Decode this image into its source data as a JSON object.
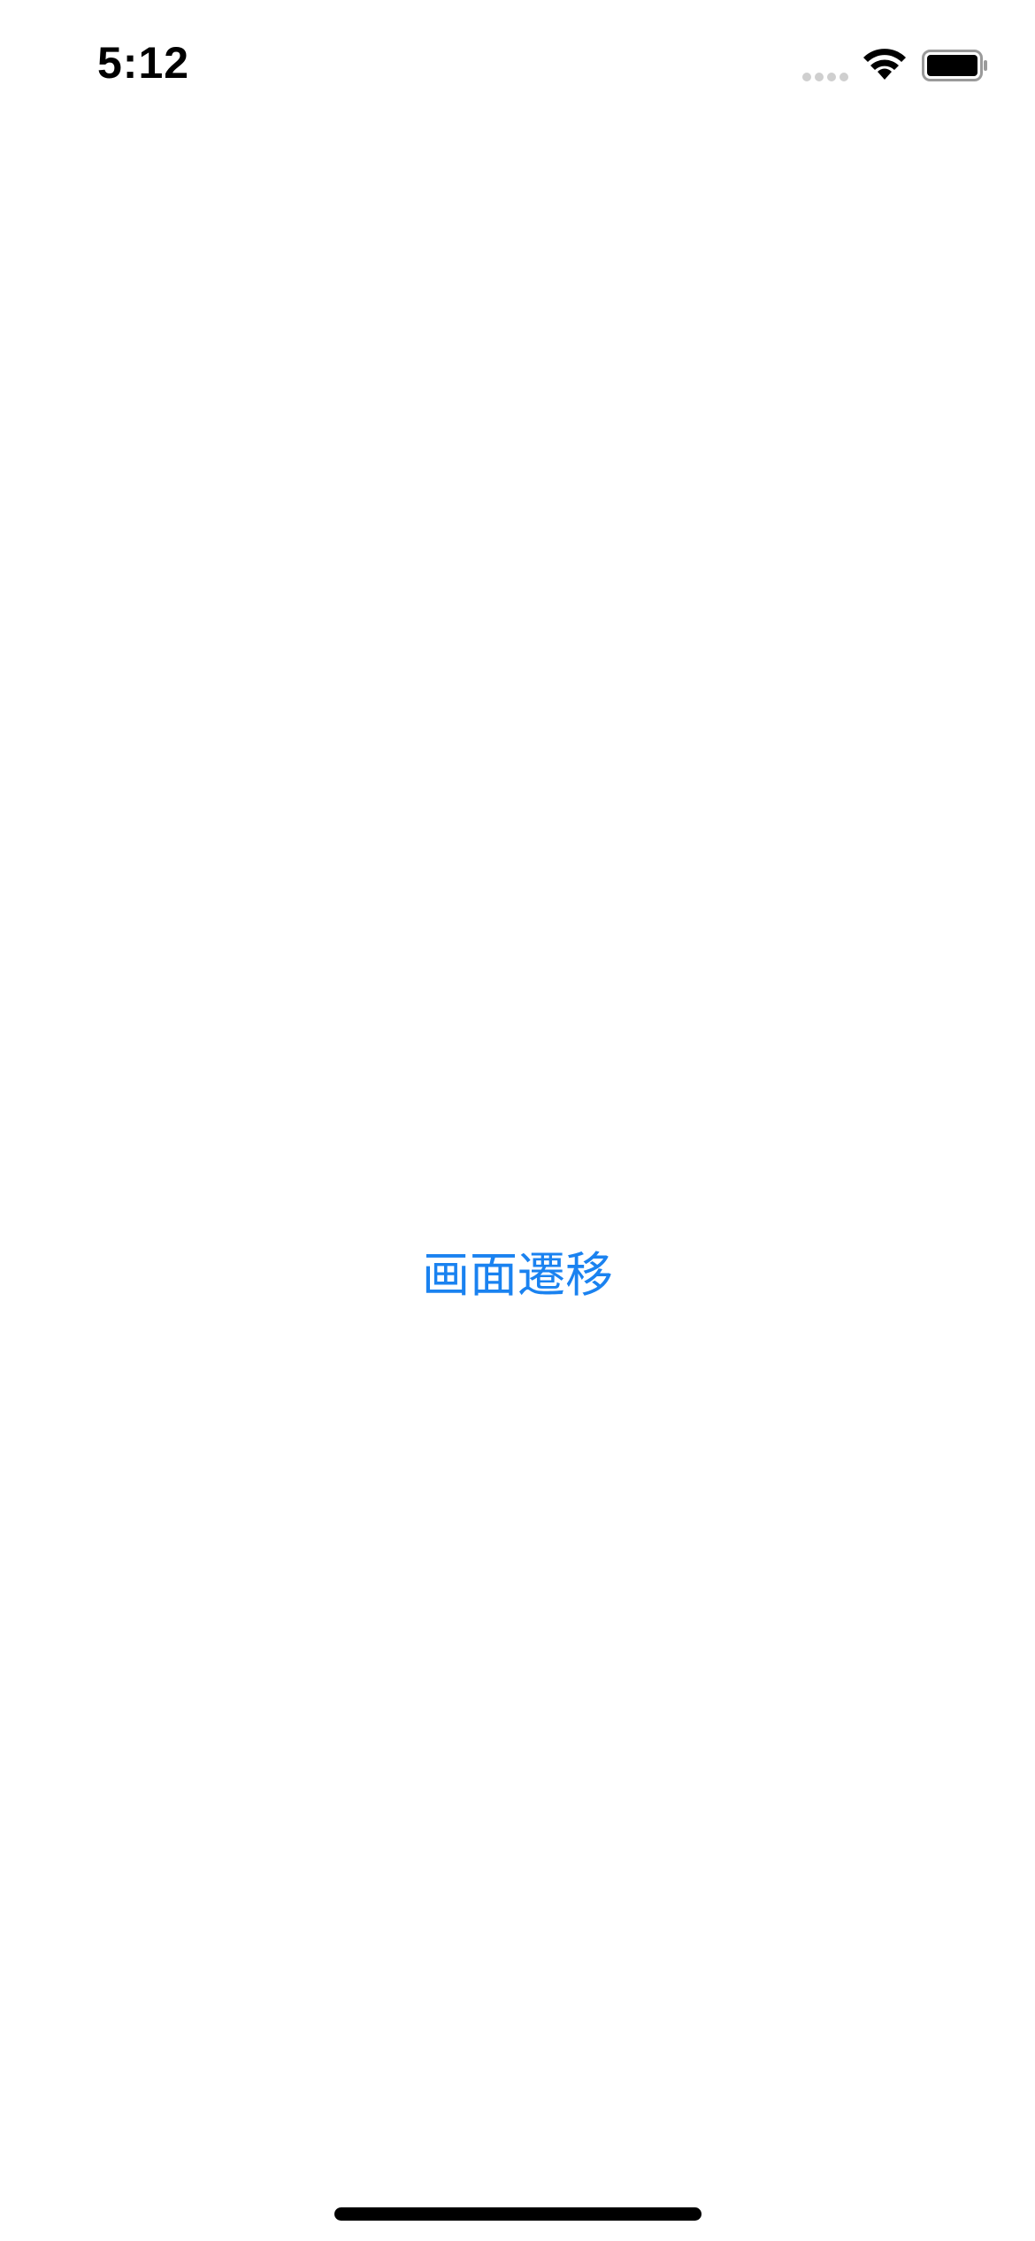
{
  "status_bar": {
    "time": "5:12",
    "icons": {
      "signal": "cellular-signal-icon",
      "wifi": "wifi-icon",
      "battery": "battery-icon"
    }
  },
  "main": {
    "transition_button_label": "画面遷移"
  },
  "colors": {
    "accent": "#1a82f0",
    "background": "#ffffff",
    "foreground": "#000000"
  }
}
